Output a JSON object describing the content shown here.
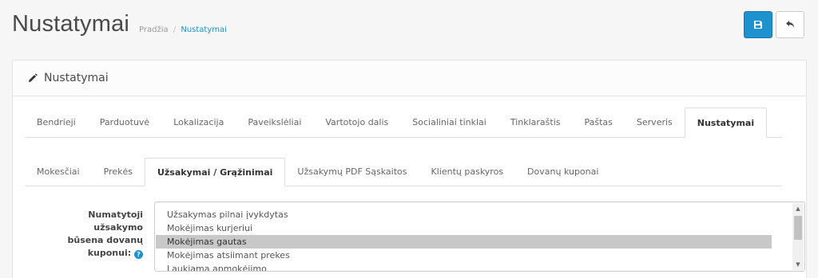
{
  "header": {
    "title": "Nustatymai",
    "breadcrumb": {
      "home": "Pradžia",
      "separator": "/",
      "current": "Nustatymai"
    },
    "save_icon": "save-icon",
    "back_icon": "reply-icon",
    "accent_color": "#1e91cf"
  },
  "panel": {
    "icon": "pencil-icon",
    "title": "Nustatymai"
  },
  "main_tabs": [
    {
      "label": "Bendrieji"
    },
    {
      "label": "Parduotuvė"
    },
    {
      "label": "Lokalizacija"
    },
    {
      "label": "Paveikslėliai"
    },
    {
      "label": "Vartotojo dalis"
    },
    {
      "label": "Socialiniai tinklai"
    },
    {
      "label": "Tinklaraštis"
    },
    {
      "label": "Paštas"
    },
    {
      "label": "Serveris"
    },
    {
      "label": "Nustatymai",
      "active": true
    }
  ],
  "sub_tabs": [
    {
      "label": "Mokesčiai"
    },
    {
      "label": "Prekės"
    },
    {
      "label": "Užsakymai / Grąžinimai",
      "active": true
    },
    {
      "label": "Užsakymų PDF Sąskaitos"
    },
    {
      "label": "Klientų paskyros"
    },
    {
      "label": "Dovanų kuponai"
    }
  ],
  "form": {
    "label_line1": "Numatytoji užsakymo",
    "label_line2": "būsena dovanų",
    "label_line3": "kuponui:",
    "help_icon": "question-circle-icon",
    "options": [
      {
        "label": "Užsakymas pilnai įvykdytas"
      },
      {
        "label": "Mokėjimas kurjeriui"
      },
      {
        "label": "Mokėjimas gautas",
        "selected": true
      },
      {
        "label": "Mokėjimas atsiimant prekes"
      },
      {
        "label": "Laukiama apmokėjimo"
      }
    ]
  }
}
